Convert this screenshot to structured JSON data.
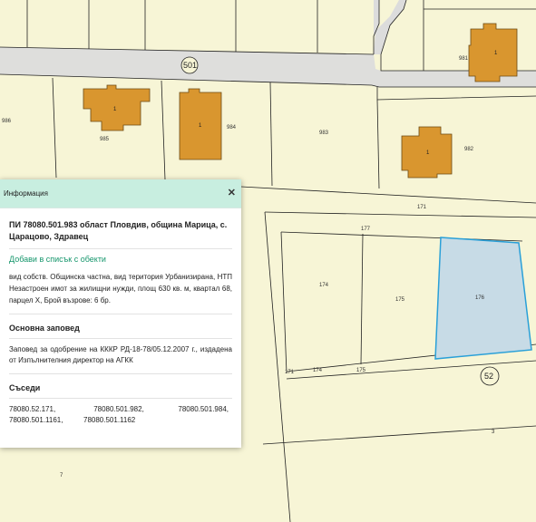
{
  "map": {
    "street_labels": [
      "501",
      "52"
    ],
    "parcel_labels": [
      "981",
      "986",
      "985",
      "984",
      "983",
      "982",
      "171",
      "177",
      "174",
      "175",
      "176",
      "174",
      "175",
      "171",
      "3",
      "7"
    ],
    "house_labels": [
      "1",
      "1",
      "1",
      "1"
    ],
    "colors": {
      "background": "#f7f5d6",
      "building": "#d9962f",
      "selected": "#c7dbe6",
      "selected_border": "#2aa0d8",
      "road": "#dcdcdc"
    }
  },
  "panel": {
    "title": "Информация",
    "close_icon": "close-icon",
    "parcel_heading": "ПИ 78080.501.983 област Пловдив, община Марица, с. Царацово, Здравец",
    "add_link": "Добави в списък с обекти",
    "description": "вид собств. Общинска частна, вид територия Урбанизирана, НТП Незастроен имот за жилищни нужди, площ 630 кв. м, квартал 68, парцел X, Брой въз­рове: 6 бр.",
    "order_title": "Основна заповед",
    "order_text": "Заповед за одобрение на КККР РД-18-78/05.12.2007 г., издадена от Изпълнителния директор на АГКК",
    "neighbors_title": "Съседи",
    "neighbors": [
      "78080.52.171,",
      "78080.501.982,",
      "78080.501.984,",
      "78080.501.1161,",
      "78080.501.1162"
    ]
  }
}
